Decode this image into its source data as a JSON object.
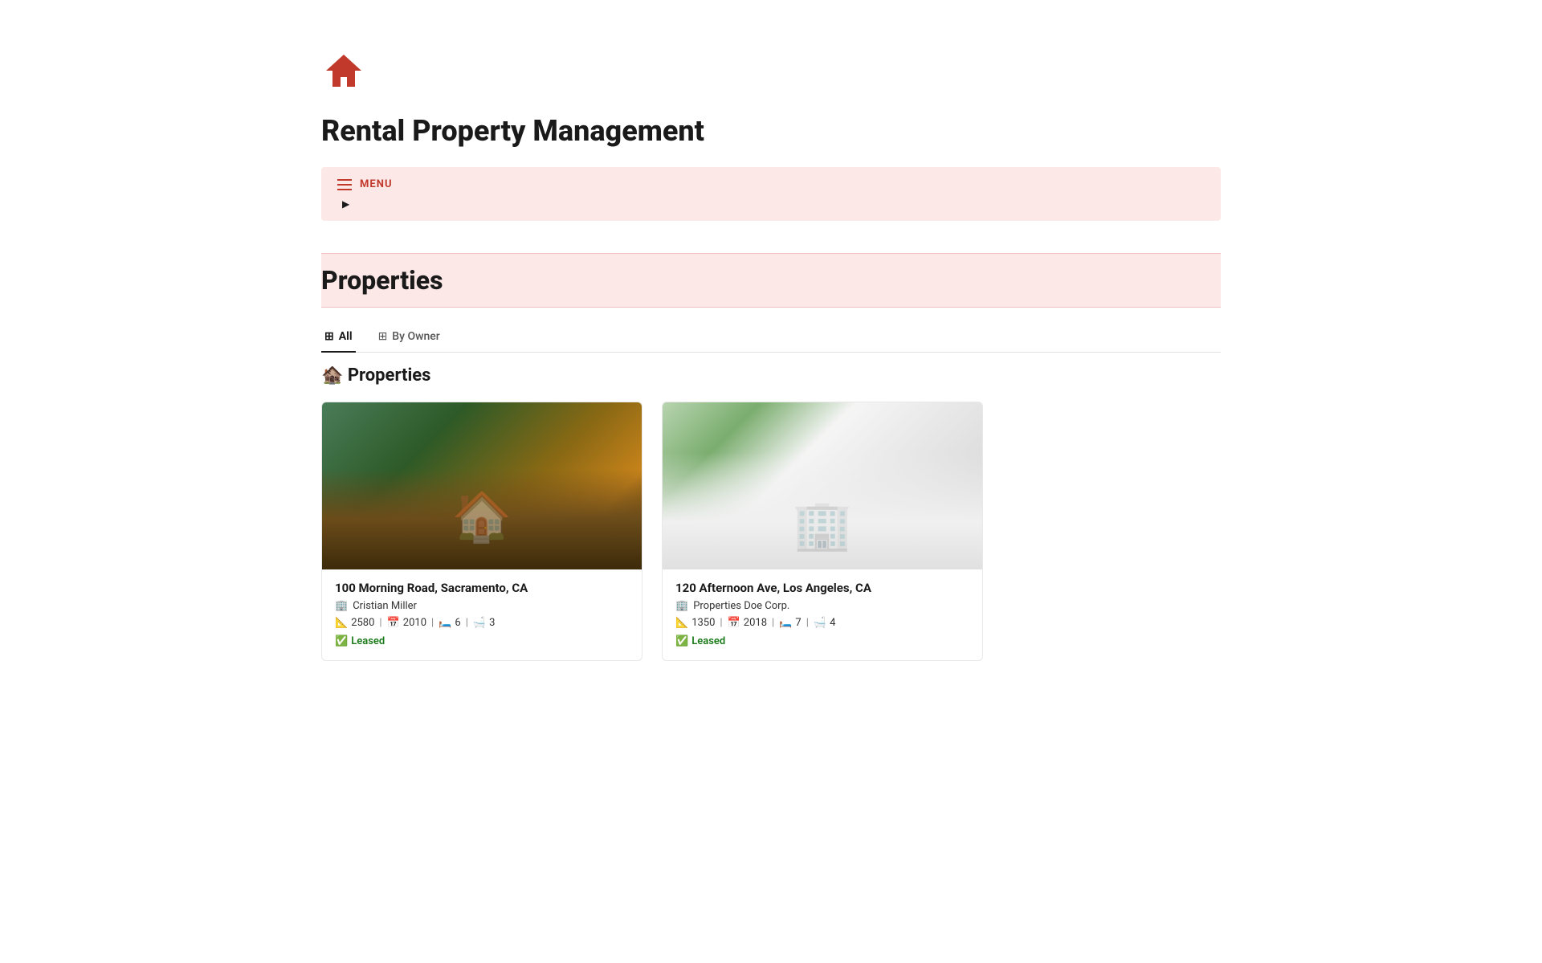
{
  "app": {
    "icon": "🏠",
    "title": "Rental Property Management"
  },
  "menu": {
    "label": "MENU",
    "arrow": "▶"
  },
  "section": {
    "title": "Properties"
  },
  "tabs": [
    {
      "id": "all",
      "label": "All",
      "icon": "⊞",
      "active": true
    },
    {
      "id": "by-owner",
      "label": "By Owner",
      "icon": "⊞",
      "active": false
    }
  ],
  "properties_heading": "🏚️ Properties",
  "properties": [
    {
      "id": 1,
      "address": "100 Morning Road, Sacramento, CA",
      "owner": "Cristian Miller",
      "owner_icon": "🏢",
      "sqft": "2580",
      "year": "2010",
      "beds": "6",
      "baths": "3",
      "status": "Leased",
      "status_emoji": "✅"
    },
    {
      "id": 2,
      "address": "120 Afternoon Ave, Los Angeles, CA",
      "owner": "Properties Doe Corp.",
      "owner_icon": "🏢",
      "sqft": "1350",
      "year": "2018",
      "beds": "7",
      "baths": "4",
      "status": "Leased",
      "status_emoji": "✅"
    }
  ],
  "icons": {
    "sqft": "📐",
    "year": "📅",
    "beds": "🛏️",
    "baths": "🛁"
  }
}
